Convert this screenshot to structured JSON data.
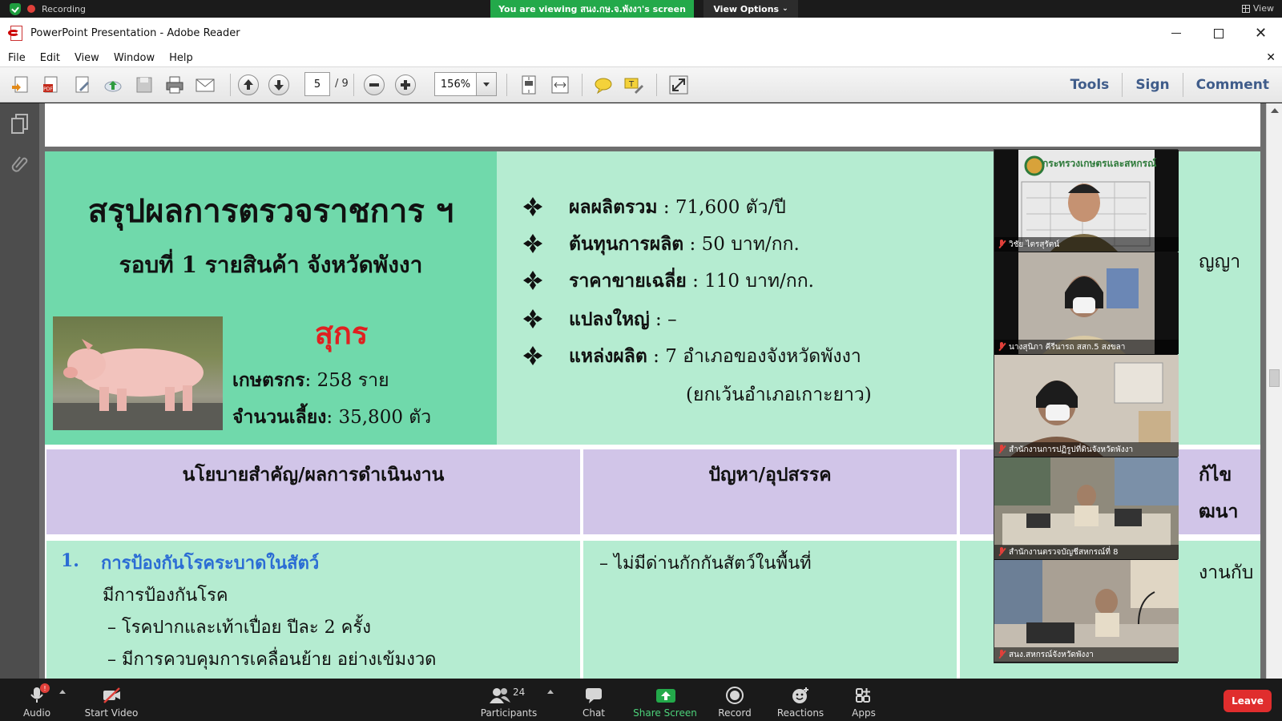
{
  "zoom_top": {
    "recording": "Recording",
    "viewing": "You are viewing สนง.กษ.จ.พังงา's screen",
    "view_options": "View Options",
    "view": "View"
  },
  "window": {
    "title": "PowerPoint Presentation - Adobe Reader"
  },
  "menu": [
    "File",
    "Edit",
    "View",
    "Window",
    "Help"
  ],
  "toolbar": {
    "page_current": "5",
    "page_total": "/ 9",
    "zoom": "156%",
    "links": [
      "Tools",
      "Sign",
      "Comment"
    ]
  },
  "slide": {
    "title": "สรุปผลการตรวจราชการ ฯ",
    "subtitle": "รอบที่ 1 รายสินค้า จังหวัดพังงา",
    "product": "สุกร",
    "farmers_label": "เกษตรกร",
    "farmers_value": ": 258 ราย",
    "herd_label": "จำนวนเลี้ยง",
    "herd_value": ": 35,800 ตัว",
    "bullets": [
      {
        "label": "ผลผลิตรวม",
        "value": " : 71,600 ตัว/ปี"
      },
      {
        "label": "ต้นทุนการผลิต",
        "value": " : 50 บาท/กก."
      },
      {
        "label": "ราคาขายเฉลี่ย",
        "value": " : 110 บาท/กก."
      },
      {
        "label": "แปลงใหญ่",
        "value": " :  –"
      },
      {
        "label": "แหล่งผลิต",
        "value": " : 7 อำเภอของจังหวัดพังงา"
      }
    ],
    "bullet_continuation": "(ยกเว้นอำเภอเกาะยาว)",
    "table_headers": [
      "นโยบายสำคัญ/ผลการดำเนินงาน",
      "ปัญหา/อุปสรรค"
    ],
    "right_clipped": [
      "ญญา",
      "ก้ไข",
      "ฒนา",
      "งานกับ"
    ],
    "col1_num": "1.",
    "col1_heading": "การป้องกันโรคระบาดในสัตว์",
    "col1_lines": [
      "มีการป้องกันโรค",
      "– โรคปากและเท้าเปื่อย ปีละ 2 ครั้ง",
      "– มีการควบคุมการเคลื่อนย้าย อย่างเข้มงวด"
    ],
    "col2_lines": [
      "– ไม่มีด่านกักกันสัตว์ในพื้นที่"
    ]
  },
  "gallery": [
    {
      "name": "วิชัย ไตรสุรัตน์",
      "bg": "#e9e9e9"
    },
    {
      "name": "นางสุนิภา คีรีนารถ สสก.5 สงขลา",
      "bg": "#b9b2a8"
    },
    {
      "name": "สำนักงานการปฏิรูปที่ดินจังหวัดพังงา",
      "bg": "#cfc7bb"
    },
    {
      "name": "สำนักงานตรวจบัญชีสหกรณ์ที่ 8",
      "bg": "#8f8a7c"
    },
    {
      "name": "สนง.สหกรณ์จังหวัดพังงา",
      "bg": "#a9a094"
    }
  ],
  "gallery_logo_text": "กระทรวงเกษตรและสหกรณ์",
  "zoom_bar": {
    "audio": "Audio",
    "audio_badge": "!",
    "start_video": "Start Video",
    "participants": "Participants",
    "participants_count": "24",
    "chat": "Chat",
    "share_screen": "Share Screen",
    "record": "Record",
    "reactions": "Reactions",
    "apps": "Apps",
    "leave": "Leave"
  },
  "colors": {
    "slide_bg": "#b5ecd1",
    "title_box": "#70d9ab",
    "header_cell": "#d1c5e8",
    "product_red": "#e02020",
    "heading_blue": "#2b6cd4",
    "share_green": "#23a94a",
    "leave_red": "#e02d2d",
    "toolbar_link": "#3f5c8a"
  }
}
